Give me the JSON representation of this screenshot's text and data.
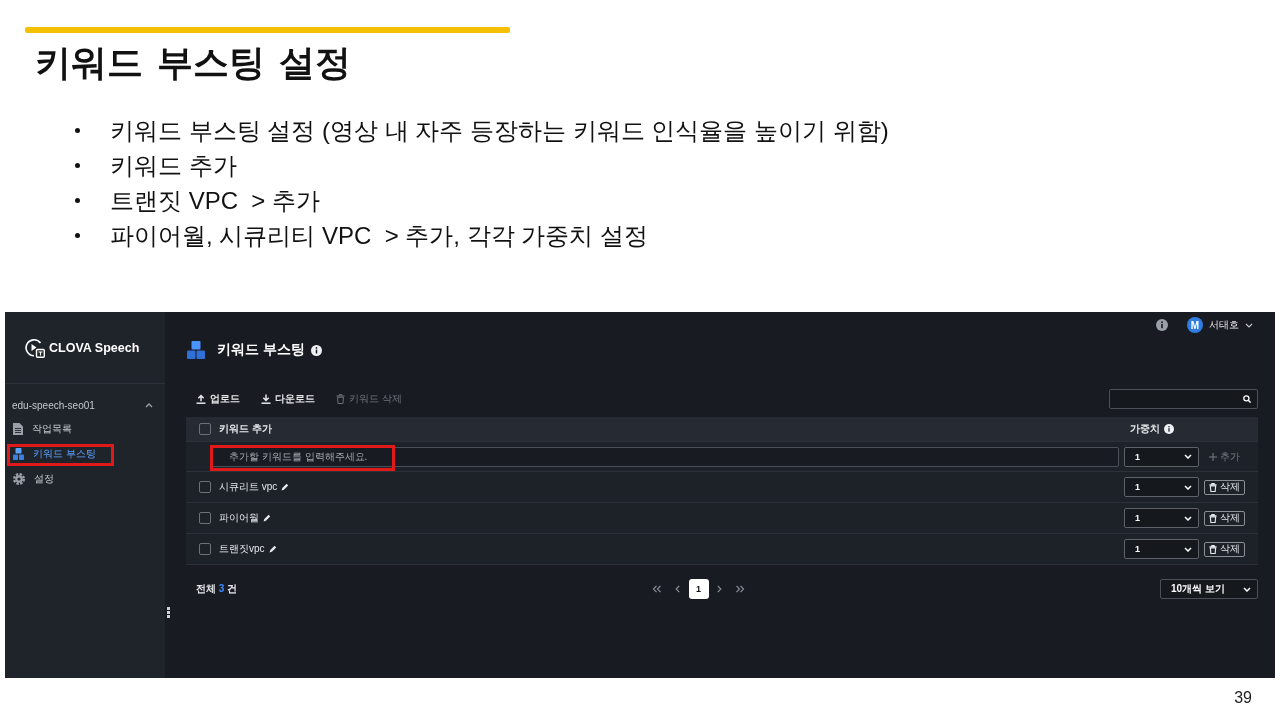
{
  "slide": {
    "title": "키워드 부스팅 설정",
    "bullets": [
      "키워드 부스팅 설정 (영상 내 자주 등장하는 키워드 인식율을 높이기 위함)",
      "키워드 추가",
      "트랜짓 VPC  > 추가",
      "파이어월, 시큐리티 VPC  > 추가, 각각 가중치 설정"
    ],
    "page_number": "39"
  },
  "app": {
    "sidebar": {
      "logo": "CLOVA Speech",
      "project": {
        "name": "edu-speech-seo01",
        "expanded": true
      },
      "items": [
        {
          "label": "작업목록",
          "kind": "document",
          "selected": false,
          "highlighted": false
        },
        {
          "label": "키워드 부스팅",
          "kind": "keyword",
          "selected": true,
          "highlighted": true
        },
        {
          "label": "설정",
          "kind": "settings",
          "selected": false,
          "highlighted": false
        }
      ]
    },
    "user": {
      "initial": "M",
      "name": "서태호"
    },
    "page_title": "키워드 부스팅",
    "toolbar": [
      {
        "label": "업로드",
        "kind": "upload",
        "disabled": false
      },
      {
        "label": "다운로드",
        "kind": "download",
        "disabled": false
      },
      {
        "label": "키워드 삭제",
        "kind": "delete",
        "disabled": true
      }
    ],
    "keyword_table": {
      "columns": [
        "키워드 추가",
        "가중치"
      ],
      "all_checked": false,
      "new_row": {
        "placeholder": "추가할 키워드를 입력해주세요.",
        "weight": "1",
        "add_label": "추가",
        "add_disabled": true,
        "highlighted": true
      },
      "rows": [
        {
          "keyword": "시큐리트 vpc",
          "weight": "1",
          "checked": false,
          "delete_label": "삭제"
        },
        {
          "keyword": "파이어월",
          "weight": "1",
          "checked": false,
          "delete_label": "삭제"
        },
        {
          "keyword": "트랜짓vpc",
          "weight": "1",
          "checked": false,
          "delete_label": "삭제"
        }
      ]
    },
    "footer": {
      "total_label": "전체",
      "total_count": "3",
      "total_unit": "건",
      "pages": [
        {
          "label": "1",
          "selected": true
        }
      ],
      "page_size": "10개씩 보기"
    }
  }
}
